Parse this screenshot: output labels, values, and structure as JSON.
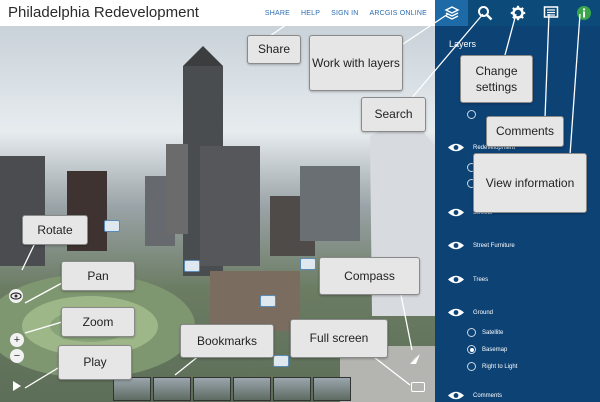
{
  "app": {
    "title": "Philadelphia Redevelopment"
  },
  "top_links": [
    "SHARE",
    "HELP",
    "SIGN IN",
    "ARCGIS ONLINE"
  ],
  "toolbar": {
    "icons": [
      "layers-icon",
      "search-icon",
      "gear-icon",
      "comments-icon",
      "info-icon"
    ],
    "accent": "#0c4a7a"
  },
  "sidebar": {
    "title": "Layers",
    "layers": [
      {
        "label": "Redevelopment",
        "sub": []
      },
      {
        "label": "Streets",
        "sub": []
      },
      {
        "label": "Street Furniture",
        "sub": []
      },
      {
        "label": "Trees",
        "sub": []
      },
      {
        "label": "Ground",
        "sub": [
          "Satellite",
          "Basemap",
          "Right to Light"
        ]
      },
      {
        "label": "Comments",
        "sub": []
      }
    ],
    "selected_ground": "Basemap",
    "bg": "#0d4275"
  },
  "callouts": {
    "share": "Share",
    "layers": "Work with layers",
    "search": "Search",
    "settings": "Change settings",
    "comments": "Comments",
    "info": "View information",
    "rotate": "Rotate",
    "pan": "Pan",
    "zoom": "Zoom",
    "play": "Play",
    "bookmarks": "Bookmarks",
    "compass": "Compass",
    "fullscreen": "Full screen"
  }
}
